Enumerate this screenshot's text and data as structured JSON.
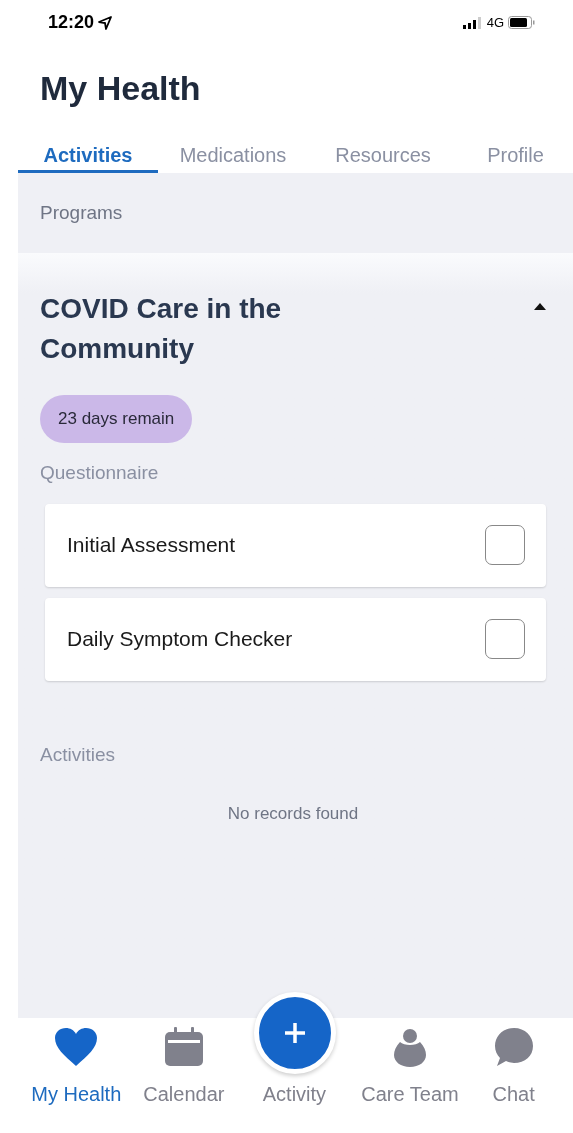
{
  "status_bar": {
    "time": "12:20",
    "network": "4G"
  },
  "title": "My Health",
  "tabs": [
    {
      "label": "Activities",
      "selected": true
    },
    {
      "label": "Medications",
      "selected": false
    },
    {
      "label": "Resources",
      "selected": false
    },
    {
      "label": "Profile",
      "selected": false
    }
  ],
  "section_label": "Programs",
  "program": {
    "title": "COVID Care in the Community",
    "expanded": true,
    "badge": "23 days remain",
    "questionnaire_label": "Questionnaire",
    "questionnaires": [
      {
        "label": "Initial Assessment",
        "checked": false
      },
      {
        "label": "Daily Symptom Checker",
        "checked": false
      }
    ],
    "activities_label": "Activities",
    "empty_text": "No records found"
  },
  "bottom_nav": [
    {
      "label": "My Health",
      "kind": "heart",
      "selected": true
    },
    {
      "label": "Calendar",
      "kind": "calendar",
      "selected": false
    },
    {
      "label": "Activity",
      "kind": "add",
      "selected": false
    },
    {
      "label": "Care Team",
      "kind": "person",
      "selected": false
    },
    {
      "label": "Chat",
      "kind": "chat",
      "selected": false
    }
  ]
}
